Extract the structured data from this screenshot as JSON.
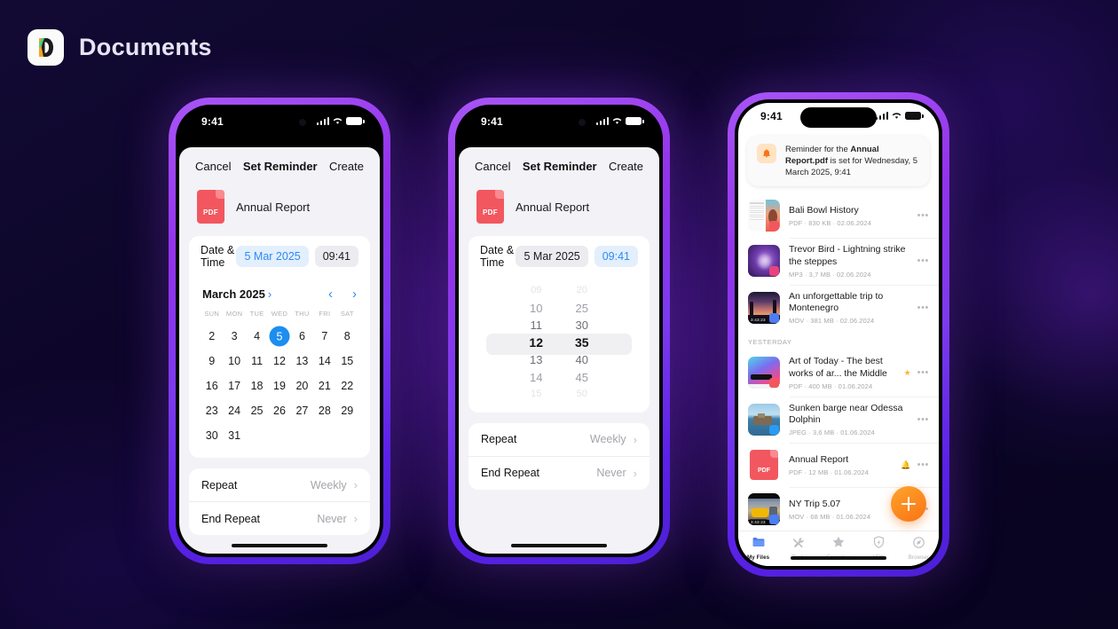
{
  "brand": {
    "title": "Documents",
    "logo_icon": "documents-app-icon"
  },
  "phone1": {
    "status": {
      "time": "9:41",
      "signal_icon": "signal-bars-icon",
      "wifi_icon": "wifi-icon",
      "battery_icon": "battery-icon"
    },
    "sheet": {
      "cancel_label": "Cancel",
      "title": "Set Reminder",
      "create_label": "Create",
      "file_name": "Annual Report",
      "file_type_badge": "PDF",
      "datetime_label": "Date & Time",
      "date_value": "5 Mar 2025",
      "time_value": "09:41",
      "active_chip": "date"
    },
    "calendar": {
      "month_label": "March 2025",
      "month_chevron": "chevron-right-icon",
      "prev_icon": "chevron-left-icon",
      "next_icon": "chevron-right-icon",
      "dow": [
        "SUN",
        "MON",
        "TUE",
        "WED",
        "THU",
        "FRI",
        "SAT"
      ],
      "leading_blanks": 0,
      "weeks": [
        [
          "2",
          "3",
          "4",
          "5",
          "6",
          "7",
          "8"
        ],
        [
          "9",
          "10",
          "11",
          "12",
          "13",
          "14",
          "15"
        ],
        [
          "16",
          "17",
          "18",
          "19",
          "20",
          "21",
          "22"
        ],
        [
          "23",
          "24",
          "25",
          "26",
          "27",
          "28",
          "29"
        ],
        [
          "30",
          "31",
          "",
          "",
          "",
          "",
          ""
        ]
      ],
      "selected_day": "5"
    },
    "repeat": [
      {
        "label": "Repeat",
        "value": "Weekly",
        "chevron": "chevron-right-icon"
      },
      {
        "label": "End Repeat",
        "value": "Never",
        "chevron": "chevron-right-icon"
      }
    ]
  },
  "phone2": {
    "status": {
      "time": "9:41"
    },
    "sheet": {
      "cancel_label": "Cancel",
      "title": "Set Reminder",
      "create_label": "Create",
      "file_name": "Annual Report",
      "file_type_badge": "PDF",
      "datetime_label": "Date & Time",
      "date_value": "5 Mar 2025",
      "time_value": "09:41",
      "active_chip": "time"
    },
    "time_picker": {
      "hours": [
        "09",
        "10",
        "11",
        "12",
        "13",
        "14",
        "15"
      ],
      "minutes": [
        "20",
        "25",
        "30",
        "35",
        "40",
        "45",
        "50"
      ],
      "selected_hour": "12",
      "selected_minute": "35"
    },
    "repeat": [
      {
        "label": "Repeat",
        "value": "Weekly",
        "chevron": "chevron-right-icon"
      },
      {
        "label": "End Repeat",
        "value": "Never",
        "chevron": "chevron-right-icon"
      }
    ]
  },
  "phone3": {
    "status": {
      "time": "9:41"
    },
    "notification": {
      "icon": "bell-icon",
      "prefix": "Reminder for the ",
      "file": "Annual Report.pdf",
      "suffix": " is set for Wednesday, 5 March 2025, 9:41"
    },
    "files": [
      {
        "title": "Bali Bowl History",
        "meta": "PDF · 830 KB · 02.06.2024",
        "thumb": "document-page-thumb",
        "badge": "pdf",
        "starred": false,
        "reminder": false,
        "duration": ""
      },
      {
        "title": "Trevor Bird - Lightning strike the steppes",
        "meta": "MP3 · 3,7 MB · 02.06.2024",
        "thumb": "music-cover-thumb",
        "badge": "mp3",
        "starred": false,
        "reminder": false,
        "duration": ""
      },
      {
        "title": "An unforgettable trip to Montenegro",
        "meta": "MOV · 381 MB · 02.06.2024",
        "thumb": "video-sunset-thumb",
        "badge": "mov",
        "starred": false,
        "reminder": false,
        "duration": "3:43:23"
      }
    ],
    "section_header": "YESTERDAY",
    "files_yesterday": [
      {
        "title": "Art of Today - The best works of ar... the Middle",
        "meta": "PDF · 400 MB · 01.06.2024",
        "thumb": "art-cover-thumb",
        "badge": "pdf",
        "starred": true,
        "reminder": false,
        "duration": ""
      },
      {
        "title": "Sunken barge near Odessa Dolphin",
        "meta": "JPEG · 3,6 MB · 01.06.2024",
        "thumb": "photo-barge-thumb",
        "badge": "jpeg",
        "starred": false,
        "reminder": false,
        "duration": ""
      },
      {
        "title": "Annual Report",
        "meta": "PDF · 12 MB · 01.06.2024",
        "thumb": "pdf-file-thumb",
        "badge": "",
        "starred": false,
        "reminder": true,
        "duration": ""
      },
      {
        "title": "NY Trip 5.07",
        "meta": "MOV · 68 MB · 01.06.2024",
        "thumb": "video-taxi-thumb",
        "badge": "mov",
        "starred": false,
        "reminder": false,
        "duration": "3:43:23"
      }
    ],
    "fab": {
      "icon": "plus-icon",
      "label": ""
    },
    "tabs": [
      {
        "label": "My Files",
        "icon": "folder-icon",
        "active": true
      },
      {
        "label": "Tools",
        "icon": "tools-icon",
        "active": false
      },
      {
        "label": "Favorites",
        "icon": "star-icon",
        "active": false
      },
      {
        "label": "VPN",
        "icon": "shield-icon",
        "active": false
      },
      {
        "label": "Browser",
        "icon": "compass-icon",
        "active": false
      }
    ]
  },
  "colors": {
    "accent_blue": "#2b8bf2",
    "accent_orange": "#f97316",
    "pdf_red": "#f2575f",
    "frame_purple": "#9333ea",
    "bg_dark": "#0a0527"
  }
}
